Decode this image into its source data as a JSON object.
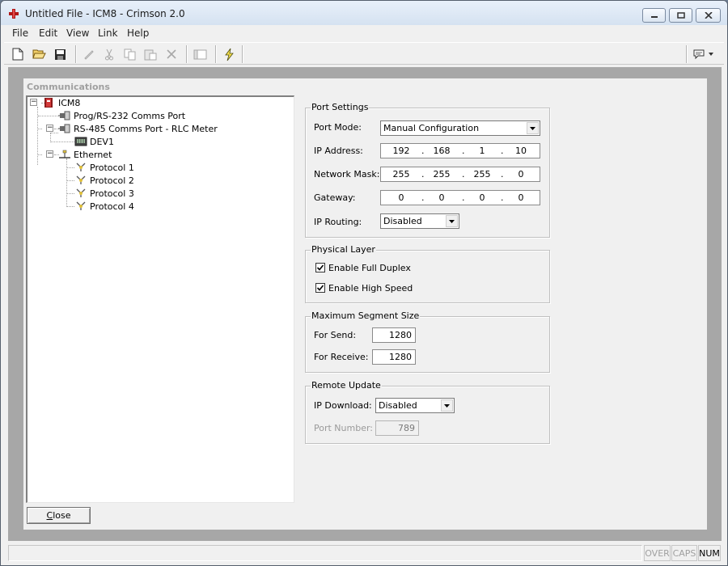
{
  "window": {
    "title": "Untitled File - ICM8 - Crimson 2.0"
  },
  "menu": [
    "File",
    "Edit",
    "View",
    "Link",
    "Help"
  ],
  "panel": {
    "title": "Communications",
    "tree": {
      "root": "ICM8",
      "prog_port": "Prog/RS-232 Comms Port",
      "rs485_port": "RS-485 Comms Port - RLC Meter",
      "device": "DEV1",
      "ethernet": "Ethernet",
      "protocols": [
        "Protocol 1",
        "Protocol 2",
        "Protocol 3",
        "Protocol 4"
      ]
    },
    "close_label_u": "C",
    "close_label_rest": "lose"
  },
  "port_settings": {
    "title": "Port Settings",
    "port_mode_label": "Port Mode:",
    "port_mode_value": "Manual Configuration",
    "ip_label": "IP Address:",
    "ip": [
      "192",
      "168",
      "1",
      "10"
    ],
    "mask_label": "Network Mask:",
    "mask": [
      "255",
      "255",
      "255",
      "0"
    ],
    "gateway_label": "Gateway:",
    "gateway": [
      "0",
      "0",
      "0",
      "0"
    ],
    "routing_label": "IP Routing:",
    "routing_value": "Disabled"
  },
  "physical_layer": {
    "title": "Physical Layer",
    "full_duplex_label": "Enable Full Duplex",
    "full_duplex_checked": true,
    "high_speed_label": "Enable High Speed",
    "high_speed_checked": true
  },
  "segment": {
    "title": "Maximum Segment Size",
    "send_label": "For Send:",
    "send_value": "1280",
    "receive_label": "For Receive:",
    "receive_value": "1280"
  },
  "remote_update": {
    "title": "Remote Update",
    "download_label": "IP Download:",
    "download_value": "Disabled",
    "port_label": "Port Number:",
    "port_value": "789"
  },
  "status": {
    "over": "OVER",
    "caps": "CAPS",
    "num": "NUM"
  }
}
